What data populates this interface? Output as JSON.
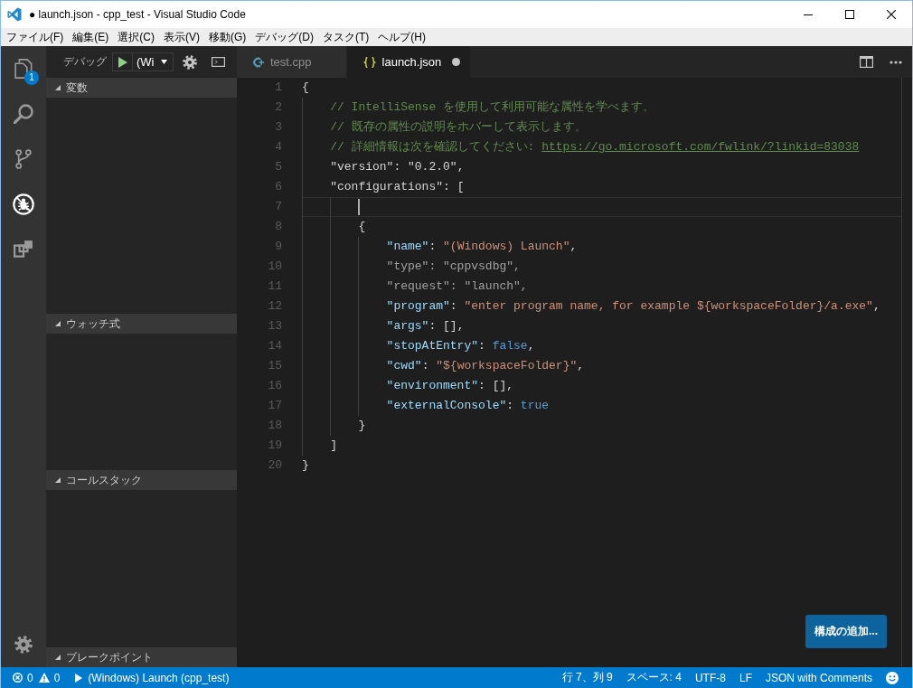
{
  "window": {
    "title": "● launch.json - cpp_test - Visual Studio Code"
  },
  "menu": [
    "ファイル(F)",
    "編集(E)",
    "選択(C)",
    "表示(V)",
    "移動(G)",
    "デバッグ(D)",
    "タスク(T)",
    "ヘルプ(H)"
  ],
  "activity_bar": {
    "items": [
      {
        "kind": "files",
        "selected": false,
        "badge": "1"
      },
      {
        "kind": "search",
        "selected": false
      },
      {
        "kind": "source-control",
        "selected": false
      },
      {
        "kind": "debug",
        "selected": true
      },
      {
        "kind": "extensions",
        "selected": false
      }
    ]
  },
  "sidebar": {
    "title": "デバッグ",
    "configuration": "(Wi",
    "sections": [
      {
        "title": "変数",
        "expanded": true
      },
      {
        "title": "ウォッチ式",
        "expanded": true
      },
      {
        "title": "コールスタック",
        "expanded": true
      },
      {
        "title": "ブレークポイント",
        "expanded": true
      }
    ]
  },
  "tabs": [
    {
      "label": "test.cpp",
      "kind": "cpp",
      "selected": false,
      "dirty": false
    },
    {
      "label": "launch.json",
      "kind": "json",
      "selected": true,
      "dirty": true
    }
  ],
  "editor": {
    "lines": [
      {
        "number": "1",
        "current": false,
        "tokens": [
          {
            "kind": "plain",
            "text": "{"
          }
        ],
        "children": [
          {
            "number": "2",
            "current": false,
            "tokens": [
              {
                "kind": "comment",
                "text": "// IntelliSense を使用して利用可能な属性を学べます。"
              }
            ]
          },
          {
            "number": "3",
            "current": false,
            "tokens": [
              {
                "kind": "comment",
                "text": "// 既存の属性の説明をホバーして表示します。"
              }
            ]
          },
          {
            "number": "4",
            "current": false,
            "tokens": [
              {
                "kind": "comment",
                "text": "// 詳細情報は次を確認してください: "
              },
              {
                "kind": "link",
                "text": "https://go.microsoft.com/fwlink/?linkid=83038"
              }
            ]
          },
          {
            "number": "5",
            "current": false,
            "tokens": [
              {
                "kind": "plain",
                "text": "\"version\": \"0.2.0\","
              }
            ]
          },
          {
            "number": "6",
            "current": false,
            "tokens": [
              {
                "kind": "plain",
                "text": "\"configurations\": ["
              }
            ],
            "children": [
              {
                "number": "7",
                "current": true
              },
              {
                "number": "8",
                "current": false,
                "tokens": [
                  {
                    "kind": "plain",
                    "text": "{"
                  }
                ],
                "children": [
                  {
                    "number": "9",
                    "current": false,
                    "tokens": [
                      {
                        "kind": "key",
                        "text": "\"name\""
                      },
                      {
                        "kind": "plain",
                        "text": ": "
                      },
                      {
                        "kind": "string",
                        "text": "\"(Windows) Launch\""
                      },
                      {
                        "kind": "plain",
                        "text": ","
                      }
                    ]
                  },
                  {
                    "number": "10",
                    "current": false,
                    "tokens": [
                      {
                        "kind": "dim",
                        "text": "\"type\": \"cppvsdbg\","
                      }
                    ]
                  },
                  {
                    "number": "11",
                    "current": false,
                    "tokens": [
                      {
                        "kind": "dim",
                        "text": "\"request\": \"launch\","
                      }
                    ]
                  },
                  {
                    "number": "12",
                    "current": false,
                    "tokens": [
                      {
                        "kind": "key",
                        "text": "\"program\""
                      },
                      {
                        "kind": "plain",
                        "text": ": "
                      },
                      {
                        "kind": "string",
                        "text": "\"enter program name, for example ${workspaceFolder}/a.exe\""
                      },
                      {
                        "kind": "plain",
                        "text": ","
                      }
                    ]
                  },
                  {
                    "number": "13",
                    "current": false,
                    "tokens": [
                      {
                        "kind": "key",
                        "text": "\"args\""
                      },
                      {
                        "kind": "plain",
                        "text": ": [],"
                      }
                    ]
                  },
                  {
                    "number": "14",
                    "current": false,
                    "tokens": [
                      {
                        "kind": "key",
                        "text": "\"stopAtEntry\""
                      },
                      {
                        "kind": "plain",
                        "text": ": "
                      },
                      {
                        "kind": "keyword",
                        "text": "false"
                      },
                      {
                        "kind": "plain",
                        "text": ","
                      }
                    ]
                  },
                  {
                    "number": "15",
                    "current": false,
                    "tokens": [
                      {
                        "kind": "key",
                        "text": "\"cwd\""
                      },
                      {
                        "kind": "plain",
                        "text": ": "
                      },
                      {
                        "kind": "string",
                        "text": "\"${workspaceFolder}\""
                      },
                      {
                        "kind": "plain",
                        "text": ","
                      }
                    ]
                  },
                  {
                    "number": "16",
                    "current": false,
                    "tokens": [
                      {
                        "kind": "key",
                        "text": "\"environment\""
                      },
                      {
                        "kind": "plain",
                        "text": ": [],"
                      }
                    ]
                  },
                  {
                    "number": "17",
                    "current": false,
                    "tokens": [
                      {
                        "kind": "key",
                        "text": "\"externalConsole\""
                      },
                      {
                        "kind": "plain",
                        "text": ": "
                      },
                      {
                        "kind": "keyword",
                        "text": "true"
                      }
                    ]
                  }
                ]
              },
              {
                "number": "18",
                "current": false,
                "tokens": [
                  {
                    "kind": "plain",
                    "text": "}"
                  }
                ]
              }
            ]
          },
          {
            "number": "19",
            "current": false,
            "tokens": [
              {
                "kind": "plain",
                "text": "]"
              }
            ]
          }
        ]
      },
      {
        "number": "20",
        "current": false,
        "tokens": [
          {
            "kind": "plain",
            "text": "}"
          }
        ]
      }
    ],
    "add_configuration_button": "構成の追加..."
  },
  "status_bar": {
    "errors": "0",
    "warnings": "0",
    "debug_target": "(Windows) Launch (cpp_test)",
    "items": [
      "行 7、列 9",
      "スペース: 4",
      "UTF-8",
      "LF",
      "JSON with Comments"
    ]
  }
}
